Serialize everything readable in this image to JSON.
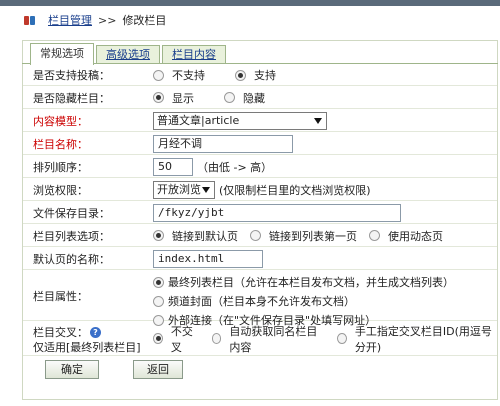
{
  "breadcrumb": {
    "link": "栏目管理",
    "arrow": ">>",
    "current": "修改栏目"
  },
  "tabs": [
    {
      "label": "常规选项"
    },
    {
      "label": "高级选项"
    },
    {
      "label": "栏目内容"
    }
  ],
  "form": {
    "submission": {
      "label": "是否支持投稿：",
      "options": [
        "不支持",
        "支持"
      ]
    },
    "hidden": {
      "label": "是否隐藏栏目：",
      "options": [
        "显示",
        "隐藏"
      ]
    },
    "model": {
      "label": "内容模型：",
      "value": "普通文章|article"
    },
    "name": {
      "label": "栏目名称：",
      "value": "月经不调"
    },
    "order": {
      "label": "排列顺序：",
      "value": "50",
      "hint": "（由低 -> 高）"
    },
    "permission": {
      "label": "浏览权限：",
      "value": "开放浏览",
      "hint": "(仅限制栏目里的文档浏览权限)"
    },
    "savedir": {
      "label": "文件保存目录：",
      "value": "/fkyz/yjbt"
    },
    "listopt": {
      "label": "栏目列表选项：",
      "options": [
        "链接到默认页",
        "链接到列表第一页",
        "使用动态页"
      ]
    },
    "defaultpage": {
      "label": "默认页的名称：",
      "value": "index.html"
    },
    "attr": {
      "label": "栏目属性：",
      "options": [
        "最终列表栏目（允许在本栏目发布文档，并生成文档列表）",
        "频道封面（栏目本身不允许发布文档）",
        "外部连接（在\"文件保存目录\"处填写网址）"
      ]
    },
    "cross": {
      "label": "栏目交叉：",
      "help": "?",
      "sublabel": "仅适用[最终列表栏目]",
      "options": [
        "不交叉",
        "自动获取同名栏目内容",
        "手工指定交叉栏目ID(用逗号分开)"
      ]
    }
  },
  "buttons": {
    "ok": "确定",
    "back": "返回"
  }
}
